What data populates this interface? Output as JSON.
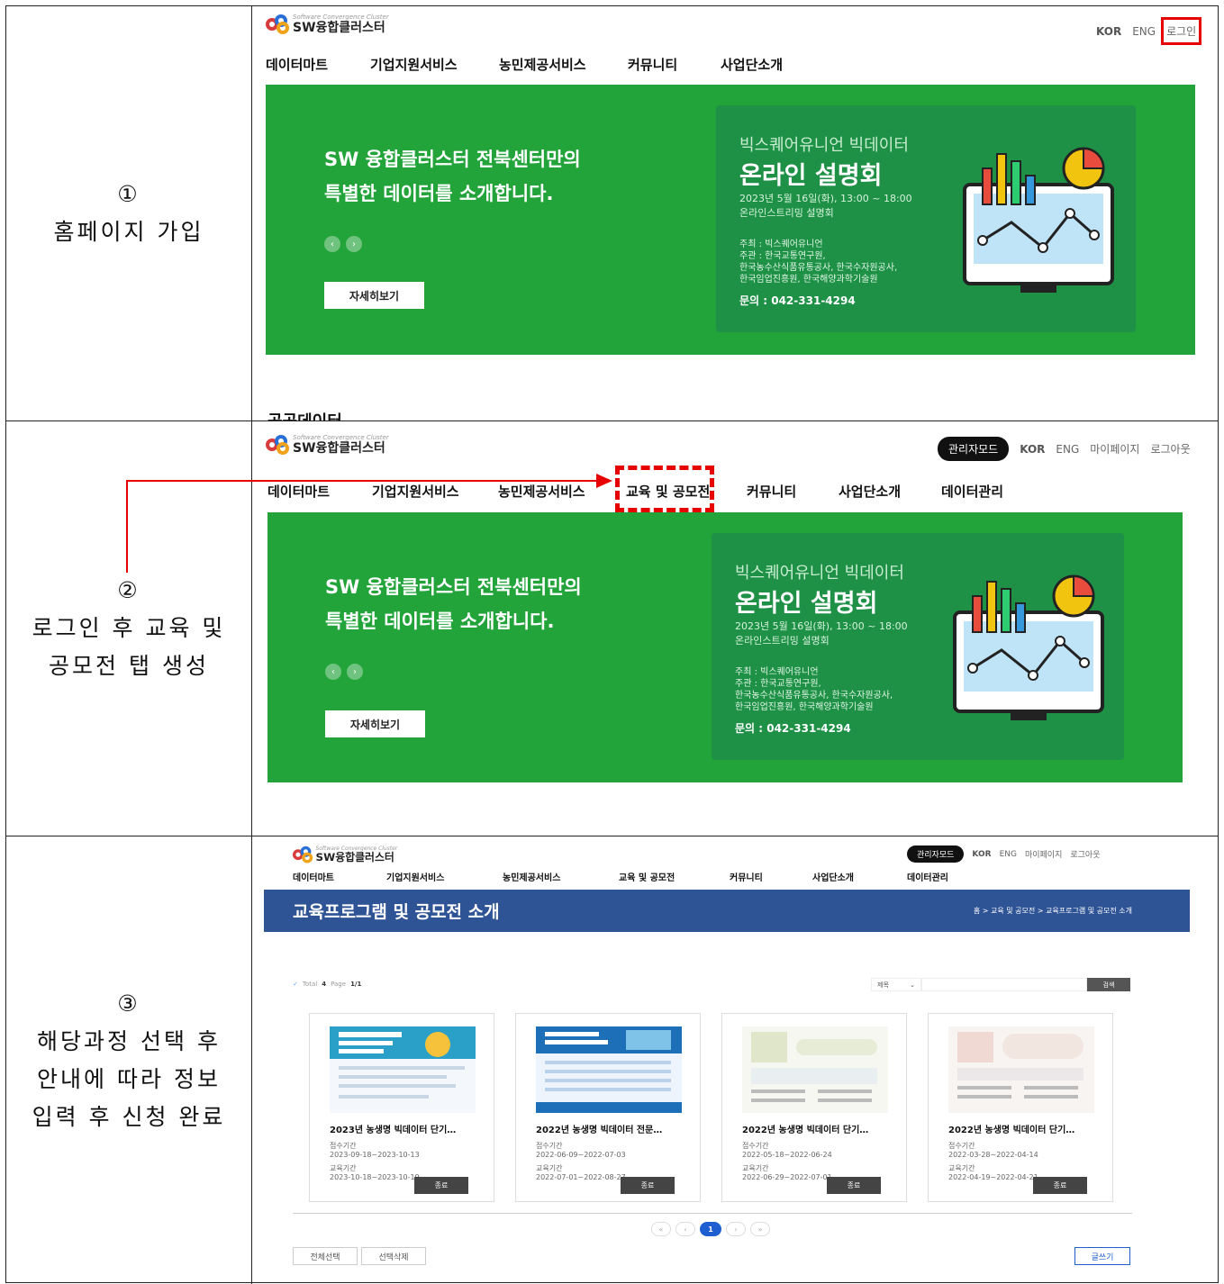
{
  "rows": [
    {
      "step": "①",
      "caption_lines": [
        "홈페이지 가입"
      ],
      "shot": {
        "logo_small": "Software Convergence Cluster",
        "logo_text": "SW융합클러스터",
        "top_links": [
          "KOR",
          "ENG",
          "로그인"
        ],
        "nav": [
          "데이터마트",
          "기업지원서비스",
          "농민제공서비스",
          "커뮤니티",
          "사업단소개"
        ],
        "banner": {
          "tagline": [
            "SW 융합클러스터 전북센터만의",
            "특별한 데이터를 소개합니다."
          ],
          "more": "자세히보기",
          "sub": "빅스퀘어유니언 빅데이터",
          "title": "온라인 설명회",
          "date": "2023년 5월 16일(화), 13:00 ~ 18:00",
          "stream": "온라인스트리밍 설명회",
          "host": "주최 : 빅스퀘어유니언",
          "org1": "주관 : 한국교통연구원,",
          "org2": "한국농수산식품유통공사, 한국수자원공사,",
          "org3": "한국임업진흥원, 한국해양과학기술원",
          "contact": "문의 : 042-331-4294"
        },
        "below": "공공데이터"
      }
    },
    {
      "step": "②",
      "caption_lines": [
        "로그인 후 교육 및",
        "공모전 탭 생성"
      ],
      "shot": {
        "logo_small": "Software Convergence Cluster",
        "logo_text": "SW융합클러스터",
        "admin": "관리자모드",
        "top_links": [
          "KOR",
          "ENG",
          "마이페이지",
          "로그아웃"
        ],
        "nav": [
          "데이터마트",
          "기업지원서비스",
          "농민제공서비스",
          "교육 및 공모전",
          "커뮤니티",
          "사업단소개",
          "데이터관리"
        ]
      }
    },
    {
      "step": "③",
      "caption_lines": [
        "해당과정 선택 후",
        "안내에 따라 정보",
        "입력 후 신청 완료"
      ],
      "shot": {
        "logo_small": "Software Convergence Cluster",
        "logo_text": "SW융합클러스터",
        "admin": "관리자모드",
        "top_links": [
          "KOR",
          "ENG",
          "마이페이지",
          "로그아웃"
        ],
        "nav": [
          "데이터마트",
          "기업지원서비스",
          "농민제공서비스",
          "교육 및 공모전",
          "커뮤니티",
          "사업단소개",
          "데이터관리"
        ],
        "hero_title": "교육프로그램 및 공모전 소개",
        "breadcrumb": "홈 > 교육 및 공모전 > 교육프로그램 및 공모전 소개",
        "total_label": "Total",
        "total": "4",
        "page_label": "Page",
        "page": "1/1",
        "search_select": "제목",
        "search_button": "검색",
        "cards": [
          {
            "title": "2023년 농생명 빅데이터 단기…",
            "recv_label": "접수기간",
            "recv": "2023-09-18~2023-10-13",
            "edu_label": "교육기간",
            "edu": "2023-10-18~2023-10-19",
            "status": "종료"
          },
          {
            "title": "2022년 농생명 빅데이터 전문…",
            "recv_label": "접수기간",
            "recv": "2022-06-09~2022-07-03",
            "edu_label": "교육기간",
            "edu": "2022-07-01~2022-08-27",
            "status": "종료"
          },
          {
            "title": "2022년 농생명 빅데이터 단기…",
            "recv_label": "접수기간",
            "recv": "2022-05-18~2022-06-24",
            "edu_label": "교육기간",
            "edu": "2022-06-29~2022-07-01",
            "status": "종료"
          },
          {
            "title": "2022년 농생명 빅데이터 단기…",
            "recv_label": "접수기간",
            "recv": "2022-03-28~2022-04-14",
            "edu_label": "교육기간",
            "edu": "2022-04-19~2022-04-21",
            "status": "종료"
          }
        ],
        "pager": [
          "«",
          "‹",
          "1",
          "›",
          "»"
        ],
        "select_all": "전체선택",
        "delete_selected": "선택삭제",
        "write": "글쓰기"
      }
    }
  ],
  "colors": {
    "banner_green": "#22a43a",
    "hero_blue": "#2f5496",
    "highlight_red": "#e60000"
  }
}
